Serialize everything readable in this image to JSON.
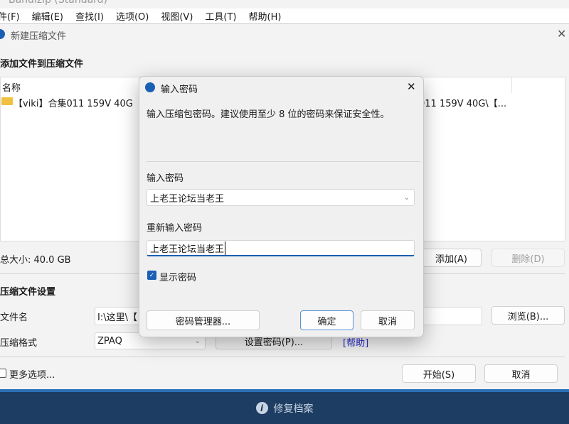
{
  "window": {
    "title": "Bandizip (Standard)"
  },
  "menu": [
    "件(F)",
    "编辑(E)",
    "查找(I)",
    "选项(O)",
    "视图(V)",
    "工具(T)",
    "帮助(H)"
  ],
  "dialog": {
    "title": "新建压缩文件",
    "section_add": "添加文件到压缩文件",
    "list": {
      "header": "名称",
      "row_name": "【viki】合集011 159V 40G",
      "row_path": "011 159V 40G\\【..."
    },
    "total_size": "总大小: 40.0 GB",
    "add_button": "添加(A)",
    "delete_button": "删除(D)",
    "section_settings": "压缩文件设置",
    "filename_label": "文件名",
    "filename_value": "I:\\这里\\【",
    "browse_button": "浏览(B)...",
    "filename_tail": "",
    "format_label": "压缩格式",
    "format_value": "ZPAQ",
    "set_password_button": "设置密码(P)...",
    "help_link": "[帮助]",
    "more_options": "更多选项...",
    "start_button": "开始(S)",
    "cancel_button": "取消"
  },
  "password_dialog": {
    "title": "输入密码",
    "description": "输入压缩包密码。建议使用至少 8 位的密码来保证安全性。",
    "password_label": "输入密码",
    "password_value": "上老王论坛当老王",
    "confirm_label": "重新输入密码",
    "confirm_value": "上老王论坛当老王",
    "show_password": "显示密码",
    "show_password_checked": true,
    "manager_button": "密码管理器...",
    "ok_button": "确定",
    "cancel_button": "取消"
  },
  "bottom_bar": {
    "label": "修复档案"
  },
  "colors": {
    "accent": "#1a5fb4",
    "bottom_bar": "#1d3d63",
    "link": "#2a2ad0"
  }
}
